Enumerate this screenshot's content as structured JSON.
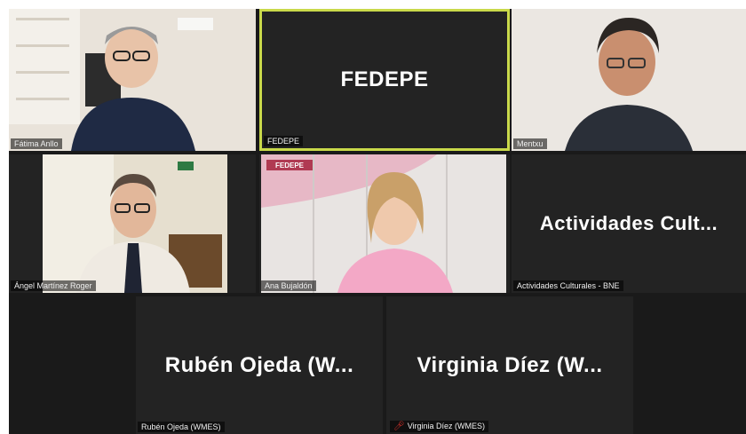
{
  "participants": [
    {
      "name": "Fátima Anllo"
    },
    {
      "name": "FEDEPE",
      "display": "FEDEPE"
    },
    {
      "name": "Mentxu"
    },
    {
      "name": "Ángel Martínez Roger"
    },
    {
      "name": "Ana Bujaldón",
      "logo": "FEDEPE"
    },
    {
      "name": "Actividades Culturales - BNE",
      "display": "Actividades Cult..."
    },
    {
      "name": "Rubén Ojeda (WMES)",
      "display": "Rubén Ojeda (W..."
    },
    {
      "name": "Virginia Díez (WMES)",
      "display": "Virginia Díez (W...",
      "muted_icon": "mic-muted-icon"
    }
  ],
  "colors": {
    "active_speaker_border": "#c9d94a",
    "tile_background": "#232323",
    "muted_mic": "#e0322b"
  }
}
